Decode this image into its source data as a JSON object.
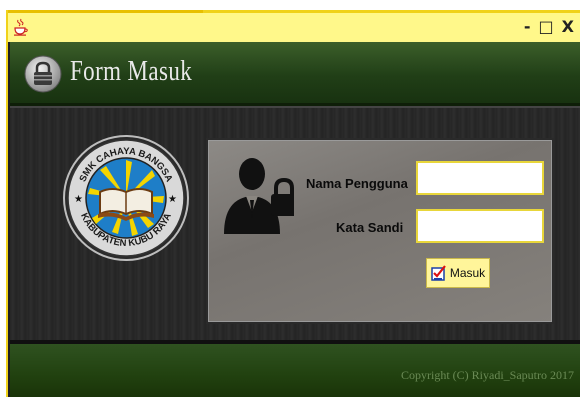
{
  "window": {
    "controls": {
      "minimize": "-",
      "maximize": "□",
      "close": "X"
    }
  },
  "header": {
    "title": "Form Masuk",
    "icon": "lock-icon"
  },
  "logo": {
    "text_top": "SMK CAHAYA BANGSA",
    "text_bottom": "KABUPATEN KUBU RAYA"
  },
  "form": {
    "username_label": "Nama Pengguna",
    "password_label": "Kata Sandi",
    "username_value": "",
    "password_value": "",
    "submit_label": "Masuk"
  },
  "footer": {
    "copyright": "Copyright (C) Riyadi_Saputro 2017"
  },
  "colors": {
    "titlebar": "#fff88a",
    "accent_yellow": "#f0d21a",
    "header_green": "#213f17",
    "panel_gray": "#7f7b77"
  }
}
